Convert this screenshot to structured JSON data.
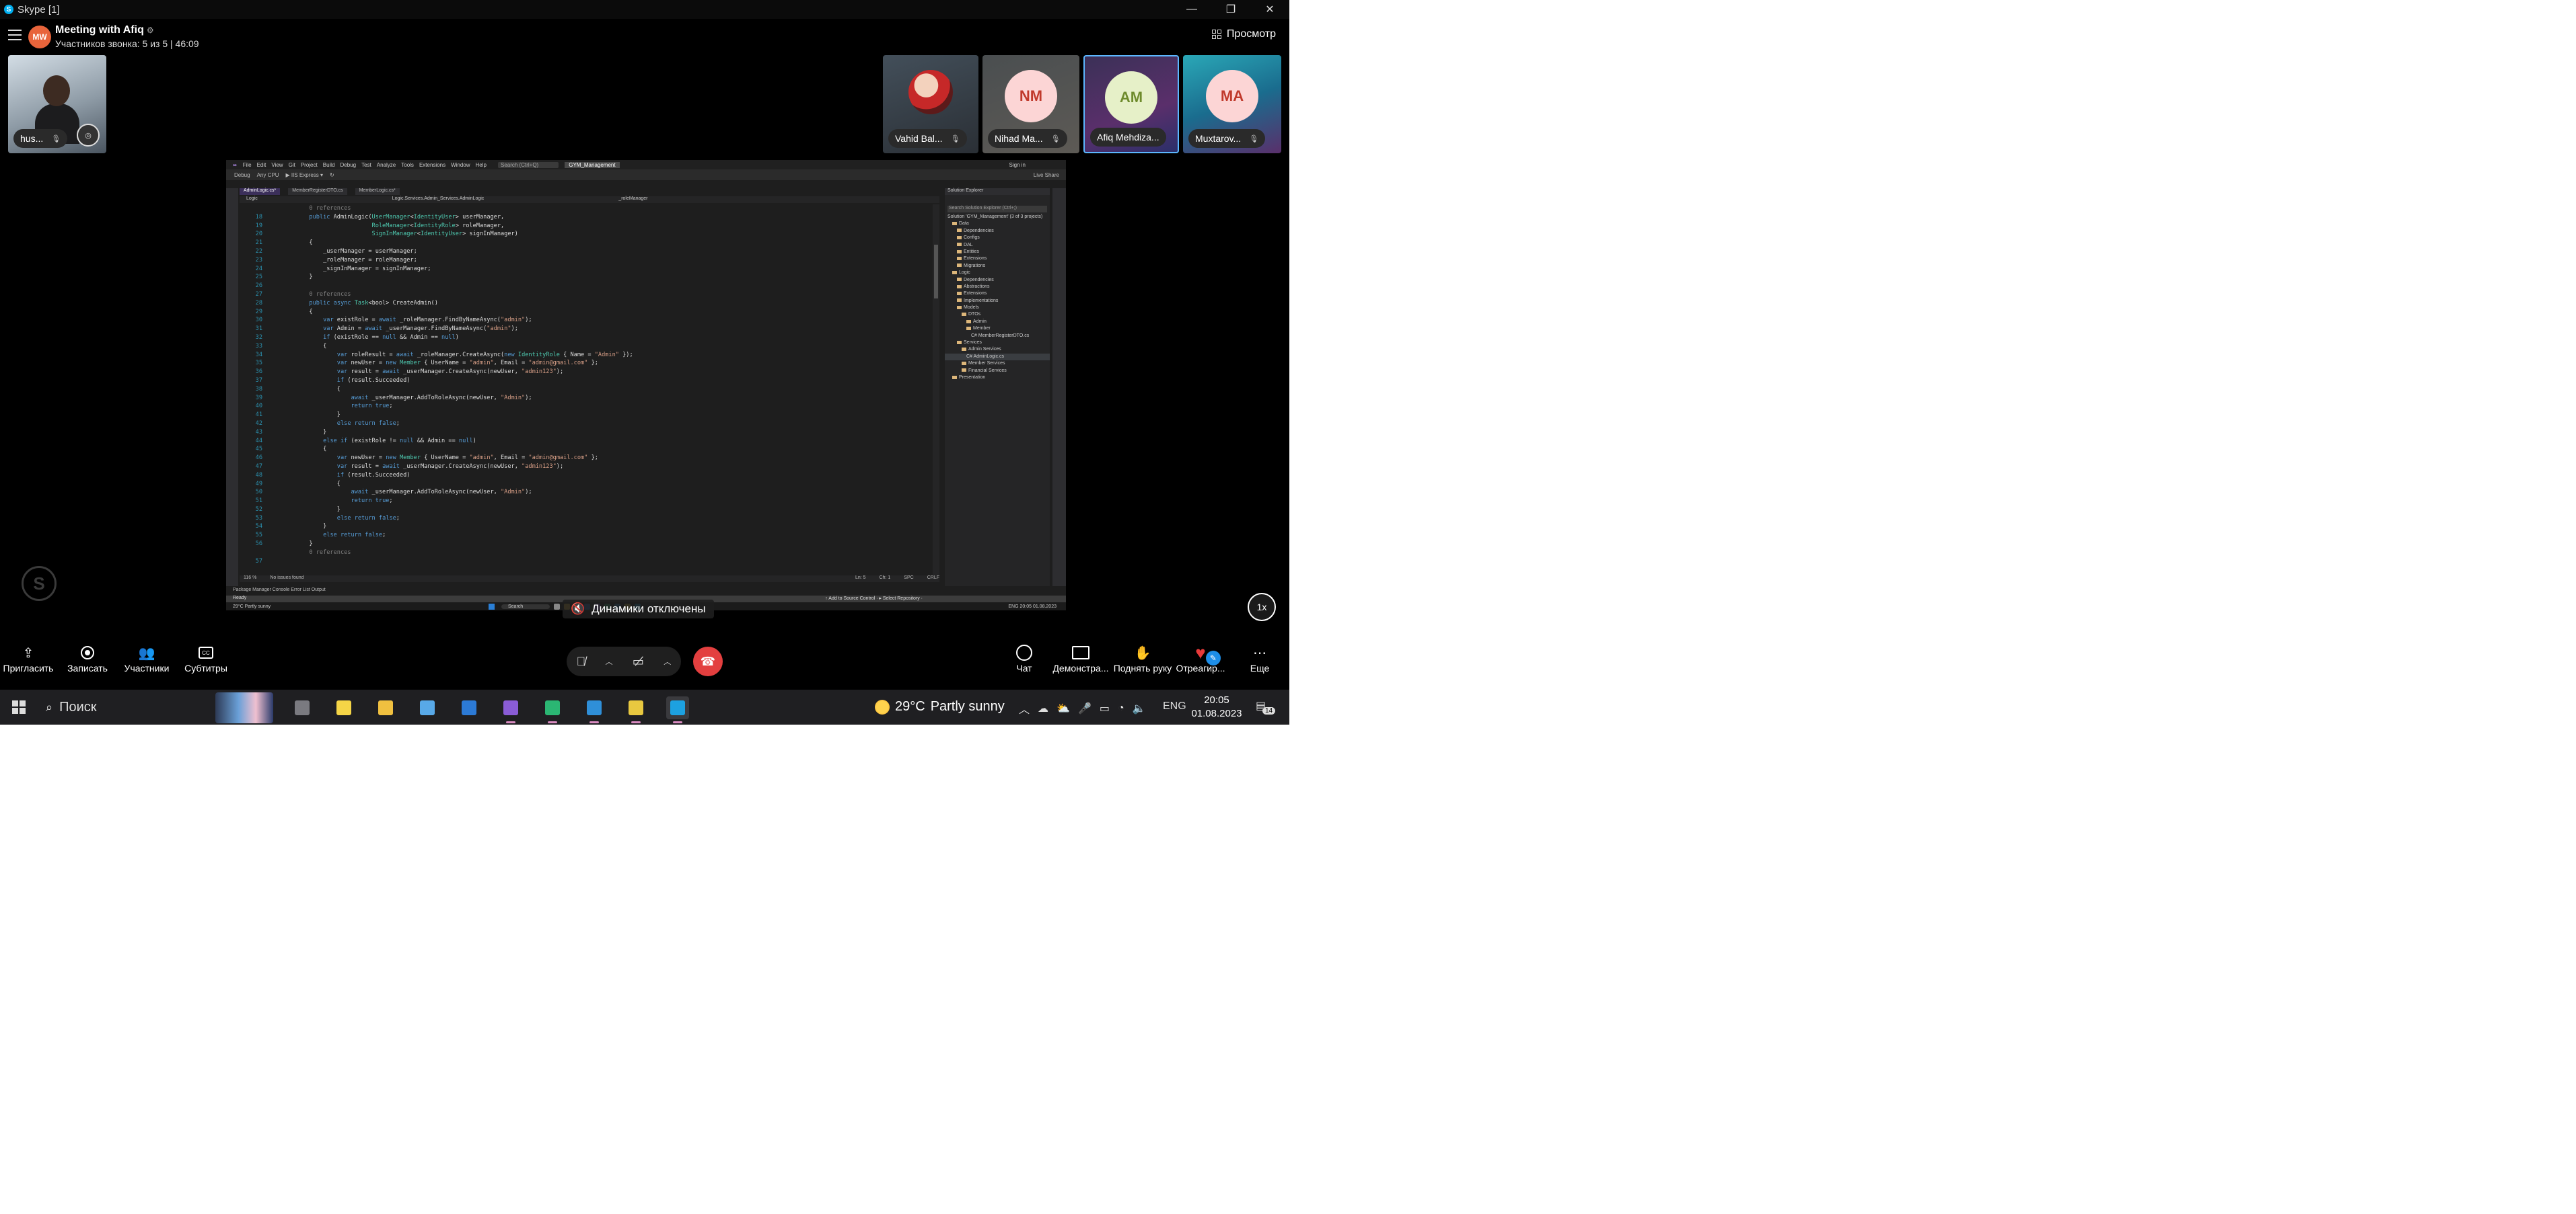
{
  "window": {
    "title": "Skype [1]",
    "minimize_glyph": "—",
    "restore_glyph": "❐",
    "close_glyph": "✕"
  },
  "meeting": {
    "avatar_initials": "MW",
    "title": "Meeting with Afiq",
    "title_icon": "⚙",
    "subtitle": "Участников звонка: 5 из 5 | 46:09",
    "view_label": "Просмотр"
  },
  "participants": {
    "self": {
      "name": "hus...",
      "mic_glyph": "🎙"
    },
    "tiles": [
      {
        "name": "Vahid Bal...",
        "initials": ""
      },
      {
        "name": "Nihad Ma...",
        "initials": "NM",
        "circle_color": "#fcd5d5",
        "text_color": "#c0392b"
      },
      {
        "name": "Afiq Mehdiza...",
        "initials": "AM",
        "circle_color": "#e6f0c8",
        "text_color": "#6e8b2c"
      },
      {
        "name": "Muxtarov...",
        "initials": "MA",
        "circle_color": "#fcd5d5",
        "text_color": "#c0392b"
      }
    ]
  },
  "vs": {
    "menu": [
      "File",
      "Edit",
      "View",
      "Git",
      "Project",
      "Build",
      "Debug",
      "Test",
      "Analyze",
      "Tools",
      "Extensions",
      "Window",
      "Help"
    ],
    "search": "Search (Ctrl+Q)",
    "project": "GYM_Management",
    "signin": "Sign in",
    "toolbar": [
      "Debug",
      "Any CPU",
      "▶ IIS Express ▾",
      "↻"
    ],
    "live_share": "Live Share",
    "tabs": [
      "AdminLogic.cs*",
      "MemberRegisterDTO.cs",
      "MemberLogic.cs*"
    ],
    "nav": [
      "Logic",
      "Logic.Services.Admin_Services.AdminLogic",
      "_roleManager"
    ],
    "code": [
      {
        "n": "",
        "t": "        0 references",
        "c": "cm"
      },
      {
        "n": "18",
        "t": "        public AdminLogic(UserManager<IdentityUser> userManager,",
        "c": ""
      },
      {
        "n": "19",
        "t": "                          RoleManager<IdentityRole> roleManager,",
        "c": ""
      },
      {
        "n": "20",
        "t": "                          SignInManager<IdentityUser> signInManager)",
        "c": ""
      },
      {
        "n": "21",
        "t": "        {",
        "c": ""
      },
      {
        "n": "22",
        "t": "            _userManager = userManager;",
        "c": ""
      },
      {
        "n": "23",
        "t": "            _roleManager = roleManager;",
        "c": ""
      },
      {
        "n": "24",
        "t": "            _signInManager = signInManager;",
        "c": ""
      },
      {
        "n": "25",
        "t": "        }",
        "c": ""
      },
      {
        "n": "26",
        "t": "",
        "c": ""
      },
      {
        "n": "27",
        "t": "        0 references",
        "c": "cm"
      },
      {
        "n": "28",
        "t": "        public async Task<bool> CreateAdmin()",
        "c": ""
      },
      {
        "n": "29",
        "t": "        {",
        "c": ""
      },
      {
        "n": "30",
        "t": "            var existRole = await _roleManager.FindByNameAsync(\"admin\");",
        "c": ""
      },
      {
        "n": "31",
        "t": "            var Admin = await _userManager.FindByNameAsync(\"admin\");",
        "c": ""
      },
      {
        "n": "32",
        "t": "            if (existRole == null && Admin == null)",
        "c": ""
      },
      {
        "n": "33",
        "t": "            {",
        "c": ""
      },
      {
        "n": "34",
        "t": "                var roleResult = await _roleManager.CreateAsync(new IdentityRole { Name = \"Admin\" });",
        "c": ""
      },
      {
        "n": "35",
        "t": "                var newUser = new Member { UserName = \"admin\", Email = \"admin@gmail.com\" };",
        "c": ""
      },
      {
        "n": "36",
        "t": "                var result = await _userManager.CreateAsync(newUser, \"admin123\");",
        "c": ""
      },
      {
        "n": "37",
        "t": "                if (result.Succeeded)",
        "c": ""
      },
      {
        "n": "38",
        "t": "                {",
        "c": ""
      },
      {
        "n": "39",
        "t": "                    await _userManager.AddToRoleAsync(newUser, \"Admin\");",
        "c": ""
      },
      {
        "n": "40",
        "t": "                    return true;",
        "c": ""
      },
      {
        "n": "41",
        "t": "                }",
        "c": ""
      },
      {
        "n": "42",
        "t": "                else return false;",
        "c": ""
      },
      {
        "n": "43",
        "t": "            }",
        "c": ""
      },
      {
        "n": "44",
        "t": "            else if (existRole != null && Admin == null)",
        "c": ""
      },
      {
        "n": "45",
        "t": "            {",
        "c": ""
      },
      {
        "n": "46",
        "t": "                var newUser = new Member { UserName = \"admin\", Email = \"admin@gmail.com\" };",
        "c": ""
      },
      {
        "n": "47",
        "t": "                var result = await _userManager.CreateAsync(newUser, \"admin123\");",
        "c": ""
      },
      {
        "n": "48",
        "t": "                if (result.Succeeded)",
        "c": ""
      },
      {
        "n": "49",
        "t": "                {",
        "c": ""
      },
      {
        "n": "50",
        "t": "                    await _userManager.AddToRoleAsync(newUser, \"Admin\");",
        "c": ""
      },
      {
        "n": "51",
        "t": "                    return true;",
        "c": ""
      },
      {
        "n": "52",
        "t": "                }",
        "c": ""
      },
      {
        "n": "53",
        "t": "                else return false;",
        "c": ""
      },
      {
        "n": "54",
        "t": "            }",
        "c": ""
      },
      {
        "n": "55",
        "t": "            else return false;",
        "c": ""
      },
      {
        "n": "56",
        "t": "        }",
        "c": ""
      },
      {
        "n": "",
        "t": "        0 references",
        "c": "cm"
      },
      {
        "n": "57",
        "t": "",
        "c": ""
      }
    ],
    "editor_status": [
      "116 %",
      "No issues found",
      "Ln: 5",
      "Ch: 1",
      "SPC",
      "CRLF"
    ],
    "output_tabs": "Package Manager Console   Error List   Output",
    "status_ready": "Ready",
    "status_right": "↑ Add to Source Control · ▸ Select Repository ·",
    "solution_title": "Solution Explorer",
    "solution_search": "Search Solution Explorer (Ctrl+;)",
    "solution": [
      {
        "d": 0,
        "t": "Solution 'GYM_Management' (3 of 3 projects)",
        "f": false
      },
      {
        "d": 1,
        "t": "Data",
        "f": true
      },
      {
        "d": 2,
        "t": "Dependencies",
        "f": true
      },
      {
        "d": 2,
        "t": "Configs",
        "f": true
      },
      {
        "d": 2,
        "t": "DAL",
        "f": true
      },
      {
        "d": 2,
        "t": "Entities",
        "f": true
      },
      {
        "d": 2,
        "t": "Extensions",
        "f": true
      },
      {
        "d": 2,
        "t": "Migrations",
        "f": true
      },
      {
        "d": 1,
        "t": "Logic",
        "f": true
      },
      {
        "d": 2,
        "t": "Dependencies",
        "f": true
      },
      {
        "d": 2,
        "t": "Abstractions",
        "f": true
      },
      {
        "d": 2,
        "t": "Extensions",
        "f": true
      },
      {
        "d": 2,
        "t": "Implementations",
        "f": true
      },
      {
        "d": 2,
        "t": "Models",
        "f": true
      },
      {
        "d": 3,
        "t": "DTOs",
        "f": true
      },
      {
        "d": 4,
        "t": "Admin",
        "f": true
      },
      {
        "d": 4,
        "t": "Member",
        "f": true
      },
      {
        "d": 5,
        "t": "C# MemberRegisterDTO.cs",
        "f": false
      },
      {
        "d": 2,
        "t": "Services",
        "f": true
      },
      {
        "d": 3,
        "t": "Admin Services",
        "f": true
      },
      {
        "d": 4,
        "t": "C# AdminLogic.cs",
        "f": false,
        "sel": true
      },
      {
        "d": 3,
        "t": "Member Services",
        "f": true
      },
      {
        "d": 3,
        "t": "Financial Services",
        "f": true
      },
      {
        "d": 1,
        "t": "Presentation",
        "f": true
      }
    ],
    "mini_taskbar": {
      "weather": "29°C Partly sunny",
      "search": "Search",
      "tray": "ENG  20:05  01.08.2023"
    }
  },
  "toast": {
    "text": "Динамики отключены"
  },
  "speed": "1x",
  "controls": {
    "invite": "Пригласить",
    "record": "Записать",
    "participants": "Участники",
    "subtitles": "Субтитры",
    "chat": "Чат",
    "share": "Демонстра...",
    "hand": "Поднять руку",
    "react": "Отреагир...",
    "more": "Еще"
  },
  "taskbar": {
    "search": "Поиск",
    "weather": "29°C",
    "weather_desc": "Partly sunny",
    "lang": "ENG",
    "time": "20:05",
    "date": "01.08.2023",
    "notifications": "14",
    "apps": [
      {
        "name": "task-view",
        "color": "#7a7a80"
      },
      {
        "name": "sticky-notes",
        "color": "#f5d547"
      },
      {
        "name": "file-explorer",
        "color": "#f0c040"
      },
      {
        "name": "ms-store",
        "color": "#58a9e8"
      },
      {
        "name": "mail",
        "color": "#2c7ad6"
      },
      {
        "name": "visual-studio",
        "color": "#8a5cd6"
      },
      {
        "name": "edge",
        "color": "#2bb673"
      },
      {
        "name": "vs-code",
        "color": "#2f8fd8"
      },
      {
        "name": "draw-app",
        "color": "#e8c840"
      },
      {
        "name": "skype",
        "color": "#1da1e0"
      }
    ]
  }
}
